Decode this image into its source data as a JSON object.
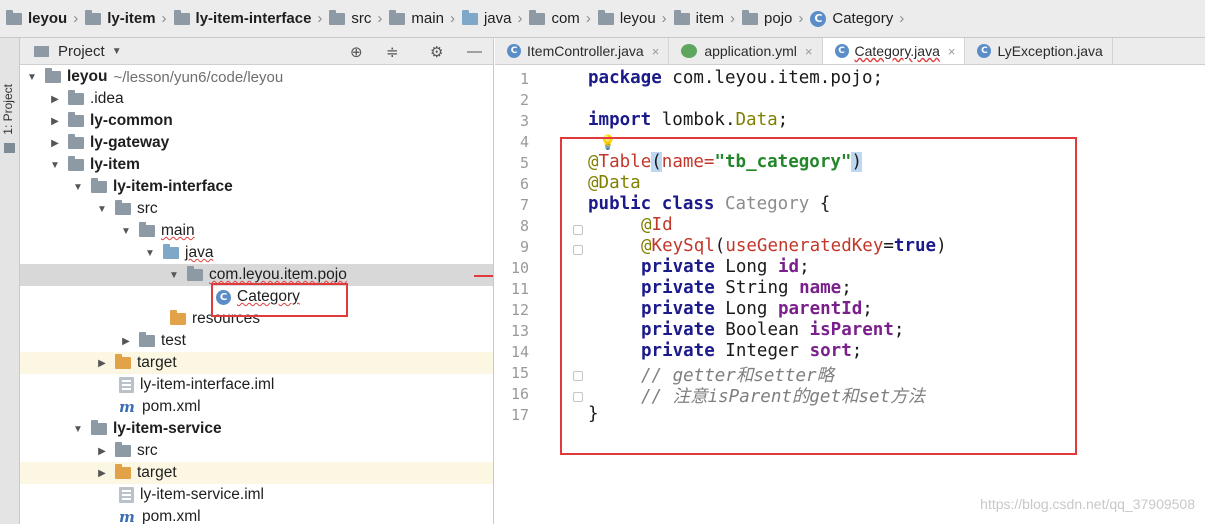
{
  "breadcrumb": [
    {
      "label": "leyou",
      "bold": true
    },
    {
      "label": "ly-item",
      "bold": true
    },
    {
      "label": "ly-item-interface",
      "bold": true
    },
    {
      "label": "src"
    },
    {
      "label": "main"
    },
    {
      "label": "java"
    },
    {
      "label": "com"
    },
    {
      "label": "leyou"
    },
    {
      "label": "item"
    },
    {
      "label": "pojo"
    },
    {
      "label": "Category",
      "icon": "class-icon"
    }
  ],
  "toolstrip": {
    "label": "1: Project"
  },
  "project_panel": {
    "title": "Project",
    "tree": [
      {
        "label": "leyou",
        "path": "~/lesson/yun6/code/leyou",
        "arrow": "down",
        "bold": true
      },
      {
        "label": ".idea",
        "arrow": "right"
      },
      {
        "label": "ly-common",
        "arrow": "right",
        "bold": true
      },
      {
        "label": "ly-gateway",
        "arrow": "right",
        "bold": true
      },
      {
        "label": "ly-item",
        "arrow": "down",
        "bold": true
      },
      {
        "label": "ly-item-interface",
        "arrow": "down",
        "bold": true
      },
      {
        "label": "src",
        "arrow": "down"
      },
      {
        "label": "main",
        "arrow": "down"
      },
      {
        "label": "java",
        "arrow": "down"
      },
      {
        "label": "com.leyou.item.pojo",
        "arrow": "down"
      },
      {
        "label": "Category"
      },
      {
        "label": "resources"
      },
      {
        "label": "test",
        "arrow": "right"
      },
      {
        "label": "target",
        "arrow": "right"
      },
      {
        "label": "ly-item-interface.iml"
      },
      {
        "label": "pom.xml"
      },
      {
        "label": "ly-item-service",
        "arrow": "down",
        "bold": true
      },
      {
        "label": "src",
        "arrow": "right"
      },
      {
        "label": "target",
        "arrow": "right"
      },
      {
        "label": "ly-item-service.iml"
      },
      {
        "label": "pom.xml"
      }
    ]
  },
  "tabs": [
    {
      "label": "ItemController.java",
      "icon": "class-icon"
    },
    {
      "label": "application.yml",
      "icon": "yml-icon"
    },
    {
      "label": "Category.java",
      "icon": "class-icon",
      "active": true
    },
    {
      "label": "LyException.java",
      "icon": "class-icon"
    }
  ],
  "editor": {
    "line_numbers": [
      "1",
      "2",
      "3",
      "4",
      "5",
      "6",
      "7",
      "8",
      "9",
      "10",
      "11",
      "12",
      "13",
      "14",
      "15",
      "16",
      "17"
    ],
    "lines": {
      "l1_kw": "package",
      "l1_rest": " com.leyou.item.pojo;",
      "l3_kw": "import",
      "l3_rest": " lombok.",
      "l3_data": "Data",
      "l3_semi": ";",
      "l5_at": "@",
      "l5_ann": "Table",
      "l5_open": "(",
      "l5_param": "name=",
      "l5_str": "\"tb_category\"",
      "l5_close": ")",
      "l6_ann": "@Data",
      "l7_kw": "public class",
      "l7_name": " Category",
      "l7_brace": " {",
      "l8_at": "@",
      "l8_ann": "Id",
      "l9_at": "@",
      "l9_ann": "KeySql",
      "l9_open": "(",
      "l9_param": "useGeneratedKey",
      "l9_eq": "=",
      "l9_val": "true",
      "l9_close": ")",
      "l10_kw": "private",
      "l10_type": " Long ",
      "l10_field": "id",
      "l10_semi": ";",
      "l11_kw": "private",
      "l11_type": " String ",
      "l11_field": "name",
      "l11_semi": ";",
      "l12_kw": "private",
      "l12_type": " Long ",
      "l12_field": "parentId",
      "l12_semi": ";",
      "l13_kw": "private",
      "l13_type": " Boolean ",
      "l13_field": "isParent",
      "l13_semi": ";",
      "l14_kw": "private",
      "l14_type": " Integer ",
      "l14_field": "sort",
      "l14_semi": ";",
      "l15_cmt": "// getter和setter略",
      "l16_cmt": "// 注意isParent的get和set方法",
      "l17": "}"
    }
  },
  "watermark": "https://blog.csdn.net/qq_37909508",
  "colors": {
    "annotation_box": "#e03a3a",
    "keyword": "#1b1a8a",
    "string": "#23862a",
    "field": "#7a1f8c"
  }
}
